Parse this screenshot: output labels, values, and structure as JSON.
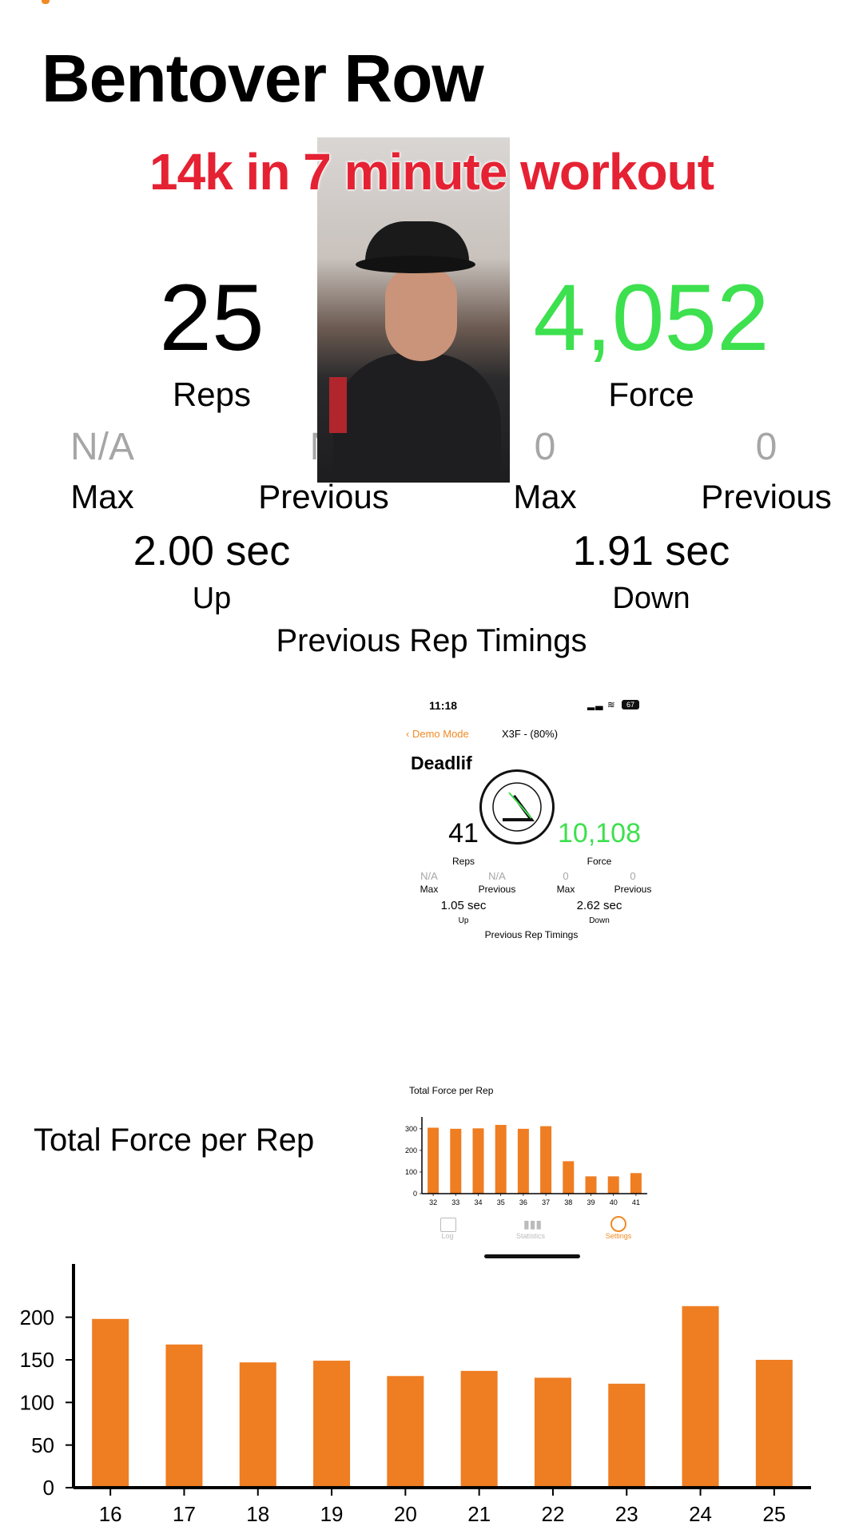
{
  "header": {
    "title": "Bentover Row"
  },
  "overlay": {
    "caption": "14k in 7 minute workout"
  },
  "stats": {
    "reps_value": "25",
    "reps_label": "Reps",
    "force_value": "4,052",
    "force_label": "Force",
    "reps_max_value": "N/A",
    "reps_max_label": "Max",
    "reps_prev_value": "N",
    "reps_prev_label": "Previous",
    "force_max_value": "0",
    "force_max_label": "Max",
    "force_prev_value": "0",
    "force_prev_label": "Previous",
    "up_time": "2.00 sec",
    "up_label": "Up",
    "down_time": "1.91 sec",
    "down_label": "Down",
    "timings_heading": "Previous Rep Timings"
  },
  "inset": {
    "time": "11:18",
    "status_icons": "signal wifi",
    "battery": "67",
    "back_label": "Demo Mode",
    "device_label": "X3F - (80%)",
    "title": "Deadlif",
    "reps_value": "41",
    "reps_label": "Reps",
    "force_value": "10,108",
    "force_label": "Force",
    "reps_max_value": "N/A",
    "reps_max_label": "Max",
    "reps_prev_value": "N/A",
    "reps_prev_label": "Previous",
    "force_max_value": "0",
    "force_max_label": "Max",
    "force_prev_value": "0",
    "force_prev_label": "Previous",
    "up_time": "1.05 sec",
    "up_label": "Up",
    "down_time": "2.62 sec",
    "down_label": "Down",
    "timings_heading": "Previous Rep Timings",
    "chart_title": "Total Force per Rep",
    "tabs": [
      {
        "label": "Log",
        "icon": "calendar-icon"
      },
      {
        "label": "Statistics",
        "icon": "bar-chart-icon"
      },
      {
        "label": "Settings",
        "icon": "settings-icon"
      }
    ]
  },
  "colors": {
    "accent": "#f08a24",
    "force_green": "#3de04e",
    "caption_red": "#e52233",
    "bar": "#ef7d22"
  },
  "chart_data": [
    {
      "type": "bar",
      "title": "Total Force per Rep",
      "categories": [
        "16",
        "17",
        "18",
        "19",
        "20",
        "21",
        "22",
        "23",
        "24",
        "25"
      ],
      "values": [
        198,
        168,
        147,
        149,
        131,
        137,
        129,
        122,
        213,
        150
      ],
      "ylim": [
        0,
        240
      ],
      "yticks": [
        0,
        50,
        100,
        150,
        200
      ]
    },
    {
      "type": "bar",
      "title": "Total Force per Rep",
      "categories": [
        "32",
        "33",
        "34",
        "35",
        "36",
        "37",
        "38",
        "39",
        "40",
        "41"
      ],
      "values": [
        305,
        300,
        302,
        318,
        300,
        312,
        150,
        80,
        80,
        95
      ],
      "ylim": [
        0,
        340
      ],
      "yticks": [
        0,
        100,
        200,
        300
      ]
    }
  ]
}
